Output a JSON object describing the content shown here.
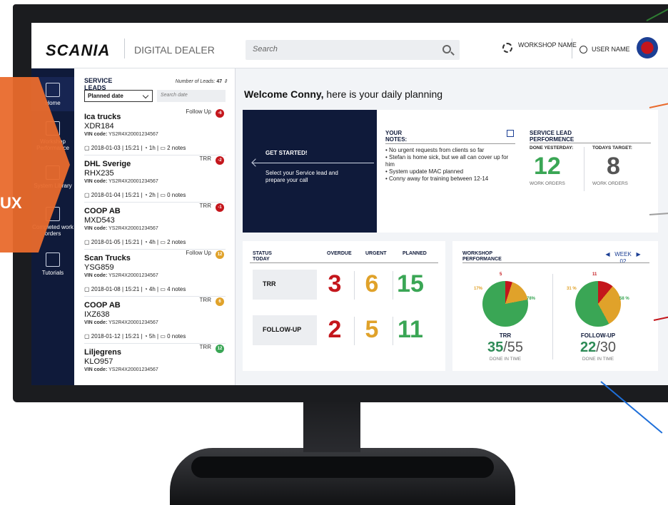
{
  "overlay": {
    "label": "UX"
  },
  "header": {
    "brand": "SCANIA",
    "app_name": "DIGITAL DEALER",
    "search_placeholder": "Search",
    "workshop_name": "WORKSHOP NAME",
    "user_name": "USER NAME"
  },
  "sidebar": {
    "items": [
      {
        "label": "Home",
        "icon": "home-icon"
      },
      {
        "label": "Workshop Performance",
        "icon": "bar-chart-icon"
      },
      {
        "label": "System Library",
        "icon": "folder-icon"
      },
      {
        "label": "Completed work orders",
        "icon": "clipboard-check-icon"
      },
      {
        "label": "Tutorials",
        "icon": "tutorial-icon"
      }
    ]
  },
  "leads": {
    "title": "SERVICE LEADS",
    "count_label": "Number of Leads:",
    "count": "47",
    "sort_value": "Planned date",
    "date_placeholder": "Search date",
    "items": [
      {
        "name": "Ica trucks",
        "plate": "XDR184",
        "vin_label": "VIN code:",
        "vin": "YS2R4X20001234567",
        "date": "2018-01-03",
        "time": "15:21",
        "duration": "1h",
        "notes": "2 notes",
        "type": "Follow Up",
        "badge": "-6",
        "badge_color": "#c4161c"
      },
      {
        "name": "DHL Sverige",
        "plate": "RHX235",
        "vin_label": "VIN code:",
        "vin": "YS2R4X20001234567",
        "date": "2018-01-04",
        "time": "15:21",
        "duration": "2h",
        "notes": "0 notes",
        "type": "TRR",
        "badge": "-2",
        "badge_color": "#c4161c"
      },
      {
        "name": "COOP AB",
        "plate": "MXD543",
        "vin_label": "VIN code:",
        "vin": "YS2R4X20001234567",
        "date": "2018-01-05",
        "time": "15:21",
        "duration": "4h",
        "notes": "2 notes",
        "type": "TRR",
        "badge": "-1",
        "badge_color": "#c4161c"
      },
      {
        "name": "Scan Trucks",
        "plate": "YSG859",
        "vin_label": "VIN code:",
        "vin": "YS2R4X20001234567",
        "date": "2018-01-08",
        "time": "15:21",
        "duration": "4h",
        "notes": "4 notes",
        "type": "Follow Up",
        "badge": "12",
        "badge_color": "#e0a22a"
      },
      {
        "name": "COOP AB",
        "plate": "IXZ638",
        "vin_label": "VIN code:",
        "vin": "YS2R4X20001234567",
        "date": "2018-01-12",
        "time": "15:21",
        "duration": "5h",
        "notes": "0 notes",
        "type": "TRR",
        "badge": "6",
        "badge_color": "#e0a22a"
      },
      {
        "name": "Liljegrens",
        "plate": "KLO957",
        "vin_label": "VIN code:",
        "vin": "YS2R4X20001234567",
        "date": "",
        "time": "",
        "duration": "",
        "notes": "",
        "type": "TRR",
        "badge": "12",
        "badge_color": "#3aa655"
      }
    ]
  },
  "main": {
    "welcome_name": "Welcome Conny,",
    "welcome_rest": " here is your daily planning",
    "get_started": {
      "title": "GET STARTED!",
      "desc": "Select your Service lead and prepare your call"
    },
    "notes": {
      "title": "YOUR NOTES:",
      "lines": [
        "• No urgent requests from clients so far",
        "• Stefan is home sick, but we all can cover up for him",
        "• System update MAC planned",
        "• Conny away for training between 12-14"
      ]
    },
    "service_perf": {
      "title": "SERVICE LEAD PERFORMENCE",
      "yesterday_label": "DONE YESTERDAY:",
      "yesterday_value": "12",
      "target_label": "TODAYS TARGET:",
      "target_value": "8",
      "unit": "WORK ORDERS"
    },
    "status": {
      "title": "STATUS TODAY",
      "columns": [
        "OVERDUE",
        "URGENT",
        "PLANNED"
      ],
      "rows": [
        {
          "label": "TRR",
          "values": [
            "3",
            "6",
            "15"
          ]
        },
        {
          "label": "FOLLOW-UP",
          "values": [
            "2",
            "5",
            "11"
          ]
        }
      ],
      "colors": [
        "#c4161c",
        "#e0a22a",
        "#3aa655"
      ]
    },
    "workshop_perf": {
      "title": "WORKSHOP PERFORMANCE",
      "week_label": "WEEK",
      "week_value": "02",
      "charts": [
        {
          "title": "TRR",
          "done": "35",
          "total": "/55",
          "caption": "DONE IN TIME",
          "red": 5,
          "orange": 17,
          "green": 78,
          "red_label": "5",
          "orange_label": "17%",
          "green_label": "78%"
        },
        {
          "title": "FOLLOW-UP",
          "done": "22",
          "total": "/30",
          "caption": "DONE IN TIME",
          "red": 11,
          "orange": 31,
          "green": 58,
          "red_label": "11",
          "orange_label": "31 %",
          "green_label": "58 %"
        }
      ]
    }
  }
}
